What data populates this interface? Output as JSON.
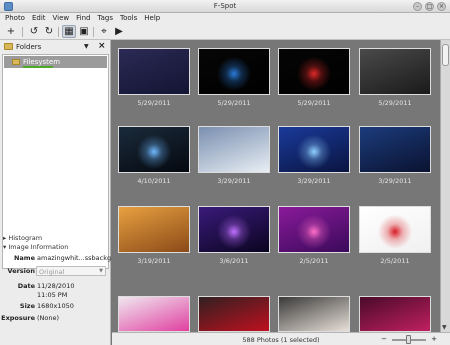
{
  "window": {
    "title": "F-Spot"
  },
  "menu": [
    "Photo",
    "Edit",
    "View",
    "Find",
    "Tags",
    "Tools",
    "Help"
  ],
  "toolbar": {
    "buttons": [
      {
        "name": "import-icon",
        "glyph": "+"
      },
      {
        "name": "rotate-left-icon",
        "glyph": "↺"
      },
      {
        "name": "rotate-right-icon",
        "glyph": "↻"
      },
      {
        "name": "browse-view-icon",
        "glyph": "▦"
      },
      {
        "name": "edit-view-icon",
        "glyph": "▣"
      },
      {
        "name": "fullscreen-icon",
        "glyph": "⌖"
      },
      {
        "name": "slideshow-icon",
        "glyph": "▶"
      }
    ]
  },
  "sidebar": {
    "header_label": "Folders",
    "tree_items": [
      "Filesystem"
    ],
    "histogram_label": "Histogram",
    "info_label": "Image Information",
    "info": {
      "name_label": "Name",
      "name_value": "amazingwhit...ssbackg.jpg",
      "version_label": "Version",
      "version_value": "Original",
      "date_label": "Date",
      "date_value_1": "11/28/2010",
      "date_value_2": "11:05 PM",
      "size_label": "Size",
      "size_value": "1680x1050",
      "exposure_label": "Exposure",
      "exposure_value": "(None)"
    }
  },
  "photos": [
    {
      "date": "5/29/2011",
      "colors": [
        "#2a2a55",
        "#141433"
      ]
    },
    {
      "date": "5/29/2011",
      "colors": [
        "#060606",
        "#000000"
      ],
      "accent": "#2a7bd8"
    },
    {
      "date": "5/29/2011",
      "colors": [
        "#050505",
        "#000000"
      ],
      "accent": "#e02828"
    },
    {
      "date": "5/29/2011",
      "colors": [
        "#4a4a4a",
        "#1a1a1a"
      ]
    },
    {
      "date": "4/10/2011",
      "colors": [
        "#1a2a3a",
        "#050910"
      ],
      "accent": "#6fb8ff"
    },
    {
      "date": "3/29/2011",
      "colors": [
        "#7a8fb0",
        "#e8eef4"
      ]
    },
    {
      "date": "3/29/2011",
      "colors": [
        "#1a3a9a",
        "#0a1440"
      ],
      "accent": "#8fd0ff"
    },
    {
      "date": "3/29/2011",
      "colors": [
        "#1c3c7c",
        "#0a1230"
      ]
    },
    {
      "date": "3/19/2011",
      "colors": [
        "#e8a040",
        "#8a4a18"
      ]
    },
    {
      "date": "3/6/2011",
      "colors": [
        "#3a1a7a",
        "#0a0520"
      ],
      "accent": "#c070ff"
    },
    {
      "date": "2/5/2011",
      "colors": [
        "#8a1a9a",
        "#3a0a5a"
      ],
      "accent": "#ff6ec7"
    },
    {
      "date": "2/5/2011",
      "colors": [
        "#ffffff",
        "#f0f0f0"
      ],
      "accent": "#d81c24"
    },
    {
      "date": "",
      "colors": [
        "#f0e8f0",
        "#e040a0"
      ]
    },
    {
      "date": "",
      "colors": [
        "#302020",
        "#c01020"
      ]
    },
    {
      "date": "",
      "colors": [
        "#3a3a3a",
        "#e8e0d8"
      ]
    },
    {
      "date": "",
      "colors": [
        "#4a0a2a",
        "#c02060"
      ]
    }
  ],
  "status": {
    "text": "588 Photos (1 selected)"
  }
}
